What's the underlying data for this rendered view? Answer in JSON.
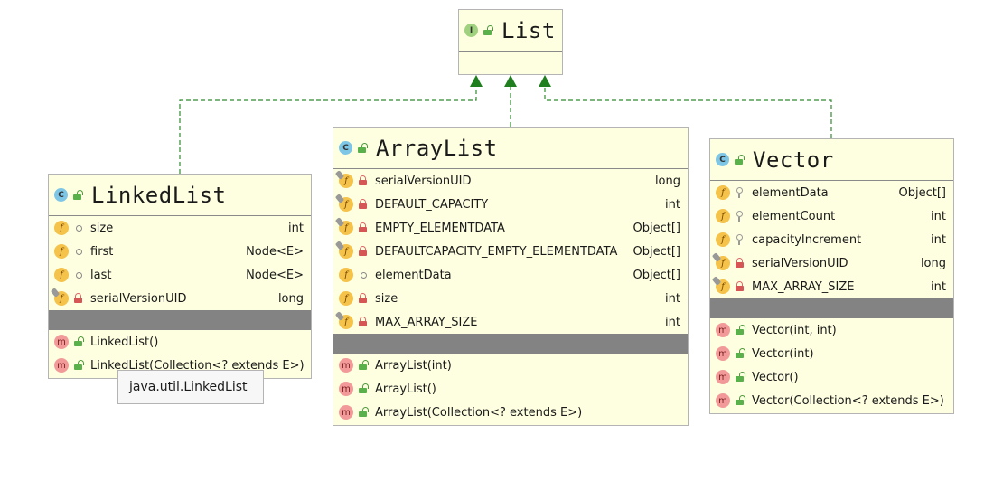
{
  "interface": {
    "name": "List",
    "kind": "I"
  },
  "linkedlist": {
    "name": "LinkedList",
    "kind": "C",
    "fields": [
      {
        "name": "size",
        "type": "int",
        "static": false,
        "vis": "package"
      },
      {
        "name": "first",
        "type": "Node<E>",
        "static": false,
        "vis": "package"
      },
      {
        "name": "last",
        "type": "Node<E>",
        "static": false,
        "vis": "package"
      },
      {
        "name": "serialVersionUID",
        "type": "long",
        "static": true,
        "vis": "private"
      }
    ],
    "methods": [
      {
        "name": "LinkedList()"
      },
      {
        "name": "LinkedList(Collection<? extends E>)"
      }
    ]
  },
  "arraylist": {
    "name": "ArrayList",
    "kind": "C",
    "fields": [
      {
        "name": "serialVersionUID",
        "type": "long",
        "static": true,
        "vis": "private"
      },
      {
        "name": "DEFAULT_CAPACITY",
        "type": "int",
        "static": true,
        "vis": "private"
      },
      {
        "name": "EMPTY_ELEMENTDATA",
        "type": "Object[]",
        "static": true,
        "vis": "private"
      },
      {
        "name": "DEFAULTCAPACITY_EMPTY_ELEMENTDATA",
        "type": "Object[]",
        "static": true,
        "vis": "private"
      },
      {
        "name": "elementData",
        "type": "Object[]",
        "static": false,
        "vis": "package"
      },
      {
        "name": "size",
        "type": "int",
        "static": false,
        "vis": "private"
      },
      {
        "name": "MAX_ARRAY_SIZE",
        "type": "int",
        "static": true,
        "vis": "private"
      }
    ],
    "methods": [
      {
        "name": "ArrayList(int)"
      },
      {
        "name": "ArrayList()"
      },
      {
        "name": "ArrayList(Collection<? extends E>)"
      }
    ]
  },
  "vector": {
    "name": "Vector",
    "kind": "C",
    "fields": [
      {
        "name": "elementData",
        "type": "Object[]",
        "static": false,
        "vis": "protected"
      },
      {
        "name": "elementCount",
        "type": "int",
        "static": false,
        "vis": "protected"
      },
      {
        "name": "capacityIncrement",
        "type": "int",
        "static": false,
        "vis": "protected"
      },
      {
        "name": "serialVersionUID",
        "type": "long",
        "static": true,
        "vis": "private"
      },
      {
        "name": "MAX_ARRAY_SIZE",
        "type": "int",
        "static": true,
        "vis": "private"
      }
    ],
    "methods": [
      {
        "name": "Vector(int, int)"
      },
      {
        "name": "Vector(int)"
      },
      {
        "name": "Vector()"
      },
      {
        "name": "Vector(Collection<? extends E>)"
      }
    ]
  },
  "tooltip": {
    "text": "java.util.LinkedList"
  },
  "colors": {
    "box_fill": "#fefee0",
    "arrow": "#2e8b2e",
    "separator": "#838383"
  }
}
